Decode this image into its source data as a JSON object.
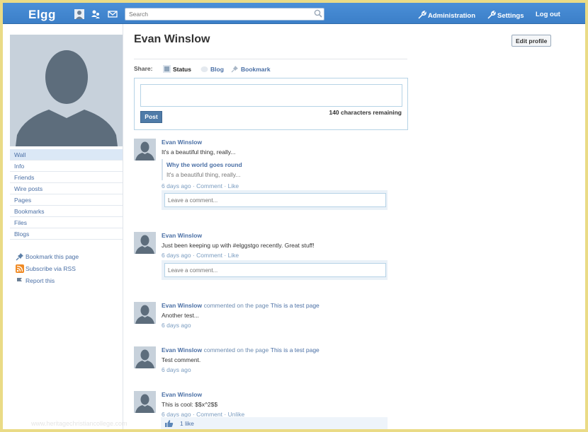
{
  "topbar": {
    "logo": "Elgg",
    "search_placeholder": "Search",
    "nav": [
      {
        "label": "Administration",
        "icon": "wrench-icon"
      },
      {
        "label": "Settings",
        "icon": "wrench-icon"
      },
      {
        "label": "Log out"
      }
    ]
  },
  "profile": {
    "name": "Evan Winslow",
    "edit_label": "Edit profile"
  },
  "sidebar": {
    "menu": [
      "Wall",
      "Info",
      "Friends",
      "Wire posts",
      "Pages",
      "Bookmarks",
      "Files",
      "Blogs"
    ],
    "active_index": 0,
    "links": [
      "Bookmark this page",
      "Subscribe via RSS",
      "Report this"
    ]
  },
  "share": {
    "label": "Share:",
    "tabs": [
      "Status",
      "Blog",
      "Bookmark"
    ],
    "remaining": "140 characters remaining",
    "post_label": "Post"
  },
  "river": [
    {
      "author": "Evan Winslow",
      "text": "It's a beautiful thing, really...",
      "attachment": {
        "title": "Why the world goes round",
        "excerpt": "It's a beautiful thing, really..."
      },
      "time": "6 days ago",
      "actions": [
        "Comment",
        "Like"
      ],
      "comment_placeholder": "Leave a comment..."
    },
    {
      "author": "Evan Winslow",
      "text": "Just been keeping up with #elggstgo recently. Great stuff!",
      "time": "6 days ago",
      "actions": [
        "Comment",
        "Like"
      ],
      "comment_placeholder": "Leave a comment..."
    },
    {
      "author": "Evan Winslow",
      "verb": "commented on the page",
      "target": "This is a test page",
      "text": "Another test...",
      "time": "6 days ago"
    },
    {
      "author": "Evan Winslow",
      "verb": "commented on the page",
      "target": "This is a test page",
      "text": "Test comment.",
      "time": "6 days ago"
    },
    {
      "author": "Evan Winslow",
      "text": "This is cool: $$x^2$$",
      "time": "6 days ago",
      "actions": [
        "Comment",
        "Unlike"
      ],
      "likes": "1 like"
    }
  ],
  "colors": {
    "topbar": "#4690d6",
    "link": "#4a6fa5",
    "frame": "#eadb86"
  },
  "watermark": "www.heritagechristiancollege.com"
}
